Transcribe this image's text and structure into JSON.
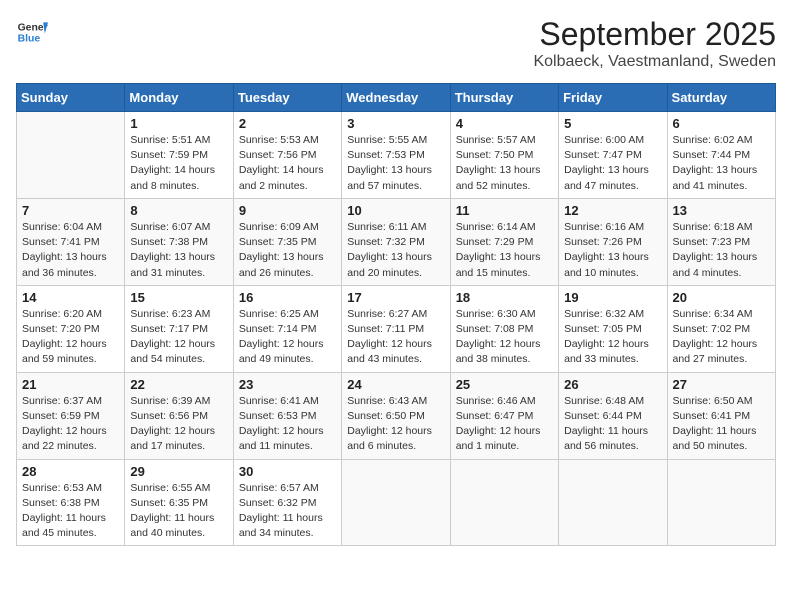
{
  "header": {
    "logo_general": "General",
    "logo_blue": "Blue",
    "title": "September 2025",
    "subtitle": "Kolbaeck, Vaestmanland, Sweden"
  },
  "calendar": {
    "weekdays": [
      "Sunday",
      "Monday",
      "Tuesday",
      "Wednesday",
      "Thursday",
      "Friday",
      "Saturday"
    ],
    "weeks": [
      [
        {
          "day": "",
          "info": ""
        },
        {
          "day": "1",
          "info": "Sunrise: 5:51 AM\nSunset: 7:59 PM\nDaylight: 14 hours\nand 8 minutes."
        },
        {
          "day": "2",
          "info": "Sunrise: 5:53 AM\nSunset: 7:56 PM\nDaylight: 14 hours\nand 2 minutes."
        },
        {
          "day": "3",
          "info": "Sunrise: 5:55 AM\nSunset: 7:53 PM\nDaylight: 13 hours\nand 57 minutes."
        },
        {
          "day": "4",
          "info": "Sunrise: 5:57 AM\nSunset: 7:50 PM\nDaylight: 13 hours\nand 52 minutes."
        },
        {
          "day": "5",
          "info": "Sunrise: 6:00 AM\nSunset: 7:47 PM\nDaylight: 13 hours\nand 47 minutes."
        },
        {
          "day": "6",
          "info": "Sunrise: 6:02 AM\nSunset: 7:44 PM\nDaylight: 13 hours\nand 41 minutes."
        }
      ],
      [
        {
          "day": "7",
          "info": "Sunrise: 6:04 AM\nSunset: 7:41 PM\nDaylight: 13 hours\nand 36 minutes."
        },
        {
          "day": "8",
          "info": "Sunrise: 6:07 AM\nSunset: 7:38 PM\nDaylight: 13 hours\nand 31 minutes."
        },
        {
          "day": "9",
          "info": "Sunrise: 6:09 AM\nSunset: 7:35 PM\nDaylight: 13 hours\nand 26 minutes."
        },
        {
          "day": "10",
          "info": "Sunrise: 6:11 AM\nSunset: 7:32 PM\nDaylight: 13 hours\nand 20 minutes."
        },
        {
          "day": "11",
          "info": "Sunrise: 6:14 AM\nSunset: 7:29 PM\nDaylight: 13 hours\nand 15 minutes."
        },
        {
          "day": "12",
          "info": "Sunrise: 6:16 AM\nSunset: 7:26 PM\nDaylight: 13 hours\nand 10 minutes."
        },
        {
          "day": "13",
          "info": "Sunrise: 6:18 AM\nSunset: 7:23 PM\nDaylight: 13 hours\nand 4 minutes."
        }
      ],
      [
        {
          "day": "14",
          "info": "Sunrise: 6:20 AM\nSunset: 7:20 PM\nDaylight: 12 hours\nand 59 minutes."
        },
        {
          "day": "15",
          "info": "Sunrise: 6:23 AM\nSunset: 7:17 PM\nDaylight: 12 hours\nand 54 minutes."
        },
        {
          "day": "16",
          "info": "Sunrise: 6:25 AM\nSunset: 7:14 PM\nDaylight: 12 hours\nand 49 minutes."
        },
        {
          "day": "17",
          "info": "Sunrise: 6:27 AM\nSunset: 7:11 PM\nDaylight: 12 hours\nand 43 minutes."
        },
        {
          "day": "18",
          "info": "Sunrise: 6:30 AM\nSunset: 7:08 PM\nDaylight: 12 hours\nand 38 minutes."
        },
        {
          "day": "19",
          "info": "Sunrise: 6:32 AM\nSunset: 7:05 PM\nDaylight: 12 hours\nand 33 minutes."
        },
        {
          "day": "20",
          "info": "Sunrise: 6:34 AM\nSunset: 7:02 PM\nDaylight: 12 hours\nand 27 minutes."
        }
      ],
      [
        {
          "day": "21",
          "info": "Sunrise: 6:37 AM\nSunset: 6:59 PM\nDaylight: 12 hours\nand 22 minutes."
        },
        {
          "day": "22",
          "info": "Sunrise: 6:39 AM\nSunset: 6:56 PM\nDaylight: 12 hours\nand 17 minutes."
        },
        {
          "day": "23",
          "info": "Sunrise: 6:41 AM\nSunset: 6:53 PM\nDaylight: 12 hours\nand 11 minutes."
        },
        {
          "day": "24",
          "info": "Sunrise: 6:43 AM\nSunset: 6:50 PM\nDaylight: 12 hours\nand 6 minutes."
        },
        {
          "day": "25",
          "info": "Sunrise: 6:46 AM\nSunset: 6:47 PM\nDaylight: 12 hours\nand 1 minute."
        },
        {
          "day": "26",
          "info": "Sunrise: 6:48 AM\nSunset: 6:44 PM\nDaylight: 11 hours\nand 56 minutes."
        },
        {
          "day": "27",
          "info": "Sunrise: 6:50 AM\nSunset: 6:41 PM\nDaylight: 11 hours\nand 50 minutes."
        }
      ],
      [
        {
          "day": "28",
          "info": "Sunrise: 6:53 AM\nSunset: 6:38 PM\nDaylight: 11 hours\nand 45 minutes."
        },
        {
          "day": "29",
          "info": "Sunrise: 6:55 AM\nSunset: 6:35 PM\nDaylight: 11 hours\nand 40 minutes."
        },
        {
          "day": "30",
          "info": "Sunrise: 6:57 AM\nSunset: 6:32 PM\nDaylight: 11 hours\nand 34 minutes."
        },
        {
          "day": "",
          "info": ""
        },
        {
          "day": "",
          "info": ""
        },
        {
          "day": "",
          "info": ""
        },
        {
          "day": "",
          "info": ""
        }
      ]
    ]
  }
}
